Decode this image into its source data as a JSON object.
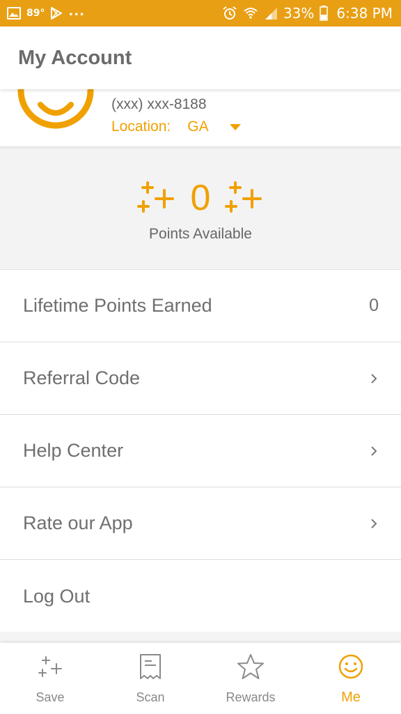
{
  "colors": {
    "accent": "#f0a000",
    "status_bar": "#e89f13"
  },
  "status_bar": {
    "temperature": "89°",
    "overflow": "...",
    "battery_percent": "33%",
    "time": "6:38 PM",
    "left_icons": [
      "image-icon",
      "play-store-icon"
    ],
    "right_icons": [
      "alarm-icon",
      "wifi-icon",
      "signal-icon",
      "battery-icon"
    ]
  },
  "header": {
    "title": "My Account"
  },
  "profile": {
    "phone": "(xxx) xxx-8188",
    "location_label": "Location:",
    "location_value": "GA"
  },
  "points": {
    "value": "0",
    "caption": "Points Available"
  },
  "menu": [
    {
      "label": "Lifetime Points Earned",
      "value": "0"
    },
    {
      "label": "Referral Code"
    },
    {
      "label": "Help Center"
    },
    {
      "label": "Rate our App"
    },
    {
      "label": "Log Out"
    }
  ],
  "nav": [
    {
      "label": "Save",
      "icon": "sparkle-plus-icon",
      "active": false
    },
    {
      "label": "Scan",
      "icon": "receipt-icon",
      "active": false
    },
    {
      "label": "Rewards",
      "icon": "star-icon",
      "active": false
    },
    {
      "label": "Me",
      "icon": "smiley-icon",
      "active": true
    }
  ]
}
